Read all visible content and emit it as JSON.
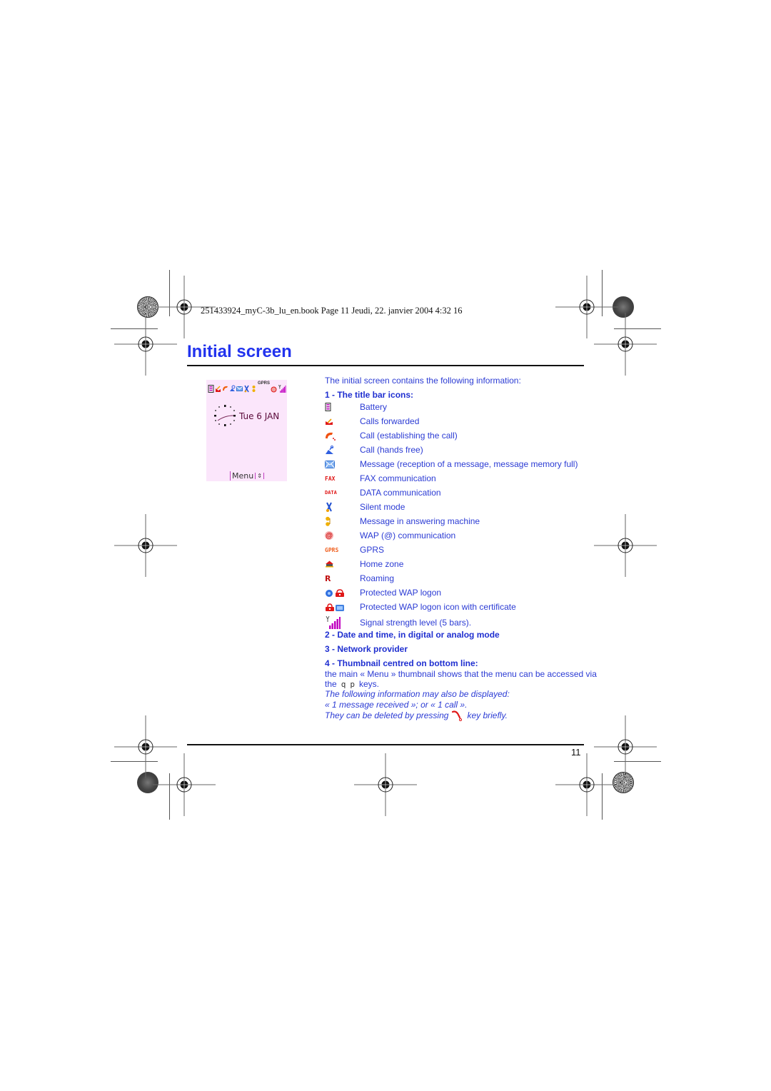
{
  "header_line": "251433924_myC-3b_lu_en.book  Page 11  Jeudi, 22. janvier 2004  4:32 16",
  "title": "Initial screen",
  "page_number": "11",
  "phone_screen": {
    "status_icons": [
      "battery-icon",
      "calls-forwarded-icon",
      "call-establishing-icon",
      "hands-free-icon",
      "message-icon",
      "silent-mode-icon",
      "answering-machine-icon",
      "gprs-icon",
      "wap-icon",
      "signal-strength-icon"
    ],
    "gprs_label": "GPRS",
    "date": "Tue 6 JAN",
    "menu_label": "Menu",
    "menu_arrows": "⇕"
  },
  "intro": "The initial screen contains the following information:",
  "section1": {
    "heading": "1 - The title bar icons:",
    "items": [
      {
        "icon": "battery-icon",
        "label": "Battery"
      },
      {
        "icon": "calls-forwarded-icon",
        "label": "Calls forwarded"
      },
      {
        "icon": "call-establishing-icon",
        "label": "Call (establishing the call)"
      },
      {
        "icon": "hands-free-icon",
        "label": "Call (hands free)"
      },
      {
        "icon": "message-icon",
        "label": "Message (reception of a message, message memory full)"
      },
      {
        "icon": "fax-icon",
        "icon_text": "FAX",
        "label": "FAX communication"
      },
      {
        "icon": "data-icon",
        "icon_text": "DATA",
        "label": "DATA communication"
      },
      {
        "icon": "silent-mode-icon",
        "label": "Silent mode"
      },
      {
        "icon": "answering-machine-icon",
        "label": "Message in answering machine"
      },
      {
        "icon": "wap-icon",
        "icon_text": "@",
        "label": "WAP (@) communication"
      },
      {
        "icon": "gprs-icon",
        "icon_text": "GPRS",
        "label": "GPRS"
      },
      {
        "icon": "home-zone-icon",
        "label": "Home zone"
      },
      {
        "icon": "roaming-icon",
        "icon_text": "R",
        "label": "Roaming"
      },
      {
        "icon": "protected-wap-icon",
        "label": "Protected WAP logon"
      },
      {
        "icon": "protected-wap-certificate-icon",
        "label": "Protected WAP logon icon with certificate"
      },
      {
        "icon": "signal-strength-icon",
        "label": "Signal strength level (5 bars)."
      }
    ]
  },
  "section2": {
    "heading": "2 - Date and time, in digital or analog mode"
  },
  "section3": {
    "heading": "3 - Network provider"
  },
  "section4": {
    "heading": "4 - Thumbnail centred on bottom line:",
    "line1": "the main « Menu » thumbnail shows that the menu can be accessed via",
    "line2_prefix": "the",
    "key1": "q",
    "key2": "p",
    "line2_suffix": "keys.",
    "italic1": "The following information may also be displayed:",
    "italic2": "« 1 message received »; or « 1 call ».",
    "italic3_prefix": "They can be deleted by pressing",
    "italic3_suffix": "key briefly."
  },
  "colors": {
    "title": "#2233ee",
    "body_text": "#2b3bd4",
    "phone_bg": "#fbe6fb",
    "icon_red": "#e01818"
  }
}
